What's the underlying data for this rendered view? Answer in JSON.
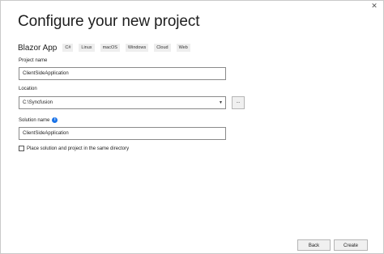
{
  "window": {
    "close_glyph": "✕"
  },
  "heading": "Configure your new project",
  "template": {
    "name": "Blazor App",
    "tags": [
      "C#",
      "Linux",
      "macOS",
      "Windows",
      "Cloud",
      "Web"
    ]
  },
  "project_name": {
    "label": "Project name",
    "value": "ClientSideApplication"
  },
  "location": {
    "label": "Location",
    "value": "C:\\Syncfusion",
    "browse_label": "..."
  },
  "solution_name": {
    "label": "Solution name",
    "info_glyph": "i",
    "value": "ClientSideApplication"
  },
  "same_directory": {
    "label": "Place solution and project in the same directory",
    "checked": false
  },
  "footer": {
    "back_label": "Back",
    "create_label": "Create"
  },
  "colors": {
    "info_icon": "#1a73e8",
    "button_bg": "#f0f0f0",
    "input_border": "#8a8a8a"
  }
}
